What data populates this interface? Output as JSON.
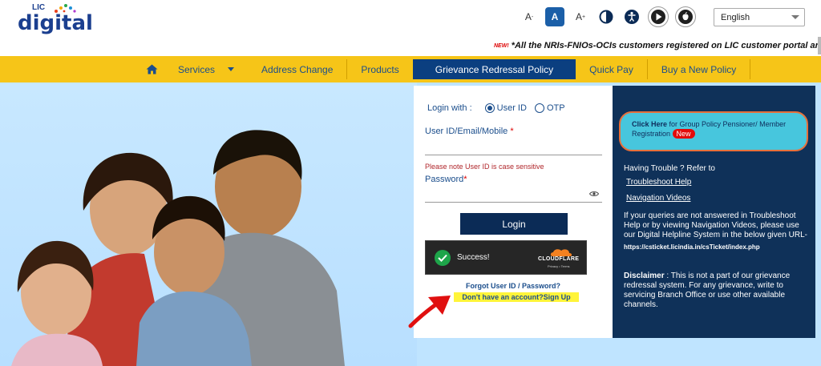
{
  "header": {
    "logo_lic": "LIC",
    "logo_digital": "digital",
    "font_small": "A",
    "font_normal": "A",
    "font_large": "A",
    "font_small_sup": "-",
    "font_large_sup": "+",
    "language_selected": "English"
  },
  "ticker": {
    "new_badge": "NEW!",
    "message": "*All the NRIs-FNIOs-OCIs customers registered on LIC customer portal are requeste"
  },
  "nav": {
    "items": [
      "Services",
      "Address Change",
      "Products",
      "Grievance Redressal Policy",
      "Quick Pay",
      "Buy a New Policy"
    ]
  },
  "login": {
    "login_with_label": "Login with :",
    "option_userid": "User ID",
    "option_otp": "OTP",
    "userid_label": "User ID/Email/Mobile",
    "required_mark": "*",
    "case_note": "Please note User ID is case sensitive",
    "password_label": "Password",
    "login_button": "Login",
    "captcha_status": "Success!",
    "captcha_brand": "CLOUDFLARE",
    "captcha_links": "Privacy • Terms",
    "forgot_link": "Forgot User ID / Password?",
    "signup_link": "Don't have an account?Sign Up"
  },
  "side_panel": {
    "group_click_here": "Click Here",
    "group_text": " for Group Policy Pensioner/ Member Registration ",
    "group_new": "New",
    "trouble_intro": "Having Trouble ? Refer to",
    "troubleshoot_link": "Troubleshoot Help",
    "navigation_link": "Navigation Videos",
    "queries_text": "If your queries are not answered in Troubleshoot Help or by viewing Navigation Videos, please use our Digital Helpline System in the below given URL-",
    "helpline_url": "https://csticket.licindia.in/csTicket/index.php",
    "disclaimer_label": "Disclaimer",
    "disclaimer_text": " : This is not a part of our grievance redressal system. For any grievance, write to servicing Branch Office or use other available channels."
  },
  "colors": {
    "navbar": "#f6c518",
    "nav_active": "#0b3f80",
    "side_panel": "#0f3159",
    "group_box": "#47c6dd",
    "hero_bg": "#bfe4ff",
    "signup_highlight": "#fff43a",
    "annotation_arrow": "#e01010"
  }
}
